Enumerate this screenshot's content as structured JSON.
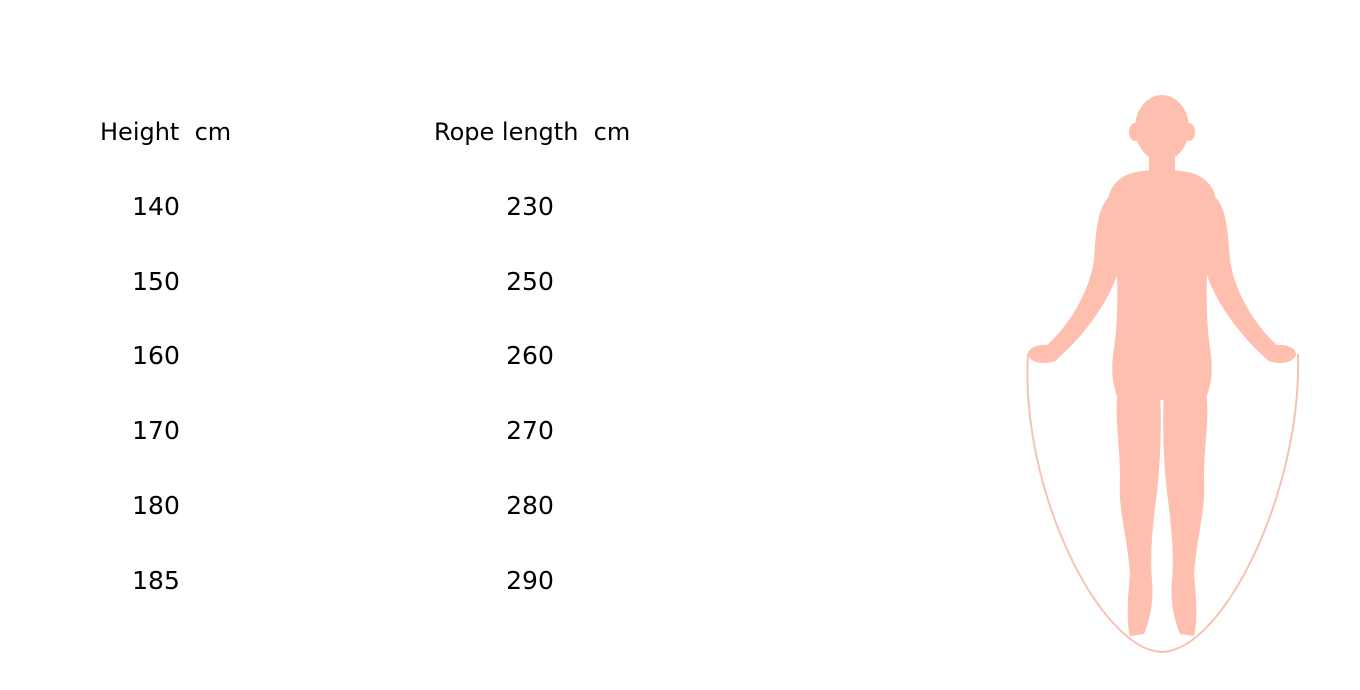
{
  "table": {
    "height_header": "Height  cm",
    "rope_header": "Rope length  cm",
    "rows": [
      {
        "height": "140",
        "rope": "230"
      },
      {
        "height": "150",
        "rope": "250"
      },
      {
        "height": "160",
        "rope": "260"
      },
      {
        "height": "170",
        "rope": "270"
      },
      {
        "height": "180",
        "rope": "280"
      },
      {
        "height": "185",
        "rope": "290"
      }
    ]
  },
  "illustration": {
    "icon": "jump-rope-person-icon",
    "figure_color": "#FFBFAE",
    "rope_color": "#F5C3B3"
  }
}
